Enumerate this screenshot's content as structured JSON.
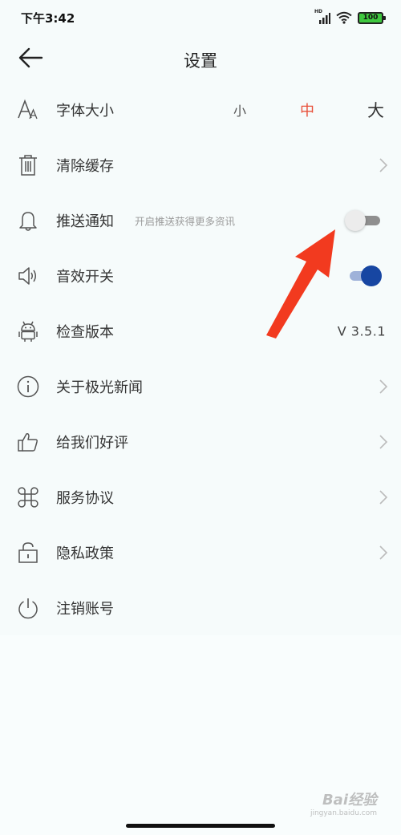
{
  "status_bar": {
    "time": "下午3:42",
    "network_label": "HD",
    "battery_level": "100"
  },
  "header": {
    "title": "设置"
  },
  "settings": {
    "font_size": {
      "label": "字体大小",
      "options": [
        "小",
        "中",
        "大"
      ],
      "selected": "中"
    },
    "clear_cache": {
      "label": "清除缓存"
    },
    "push_notification": {
      "label": "推送通知",
      "description": "开启推送获得更多资讯",
      "enabled": false
    },
    "sound_effects": {
      "label": "音效开关",
      "enabled": true
    },
    "check_version": {
      "label": "检查版本",
      "version": "V 3.5.1"
    },
    "about": {
      "label": "关于极光新闻"
    },
    "rate_us": {
      "label": "给我们好评"
    },
    "service_agreement": {
      "label": "服务协议"
    },
    "privacy_policy": {
      "label": "隐私政策"
    },
    "delete_account": {
      "label": "注销账号"
    }
  },
  "colors": {
    "accent_red": "#e8503a",
    "toggle_on": "#1746a2",
    "background": "#f6fbfb"
  },
  "watermark": {
    "main": "Bai经验",
    "sub": "jingyan.baidu.com"
  }
}
